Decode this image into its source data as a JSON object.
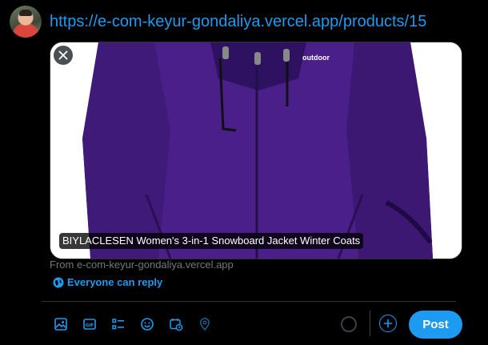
{
  "composer": {
    "text": "https://e-com-keyur-gondaliya.vercel.app/products/15",
    "avatar_icon": "user-avatar"
  },
  "link_card": {
    "title": "BIYLACLESEN Women's 3-in-1 Snowboard Jacket Winter Coats",
    "source": "From e-com-keyur-gondaliya.vercel.app",
    "image_logo_text": "outdoor",
    "remove_icon": "close-icon",
    "jacket_color": "#4a1f8a"
  },
  "reply_setting": {
    "label": "Everyone can reply",
    "icon": "globe-icon"
  },
  "toolbar": {
    "icons": [
      "image-icon",
      "gif-icon",
      "poll-icon",
      "emoji-icon",
      "schedule-icon",
      "location-icon"
    ],
    "add_icon": "plus-icon",
    "post_label": "Post",
    "char_progress": 0.0
  },
  "colors": {
    "accent": "#1d9bf0",
    "background": "#000000",
    "muted": "#71767b",
    "border": "#2f3336"
  }
}
